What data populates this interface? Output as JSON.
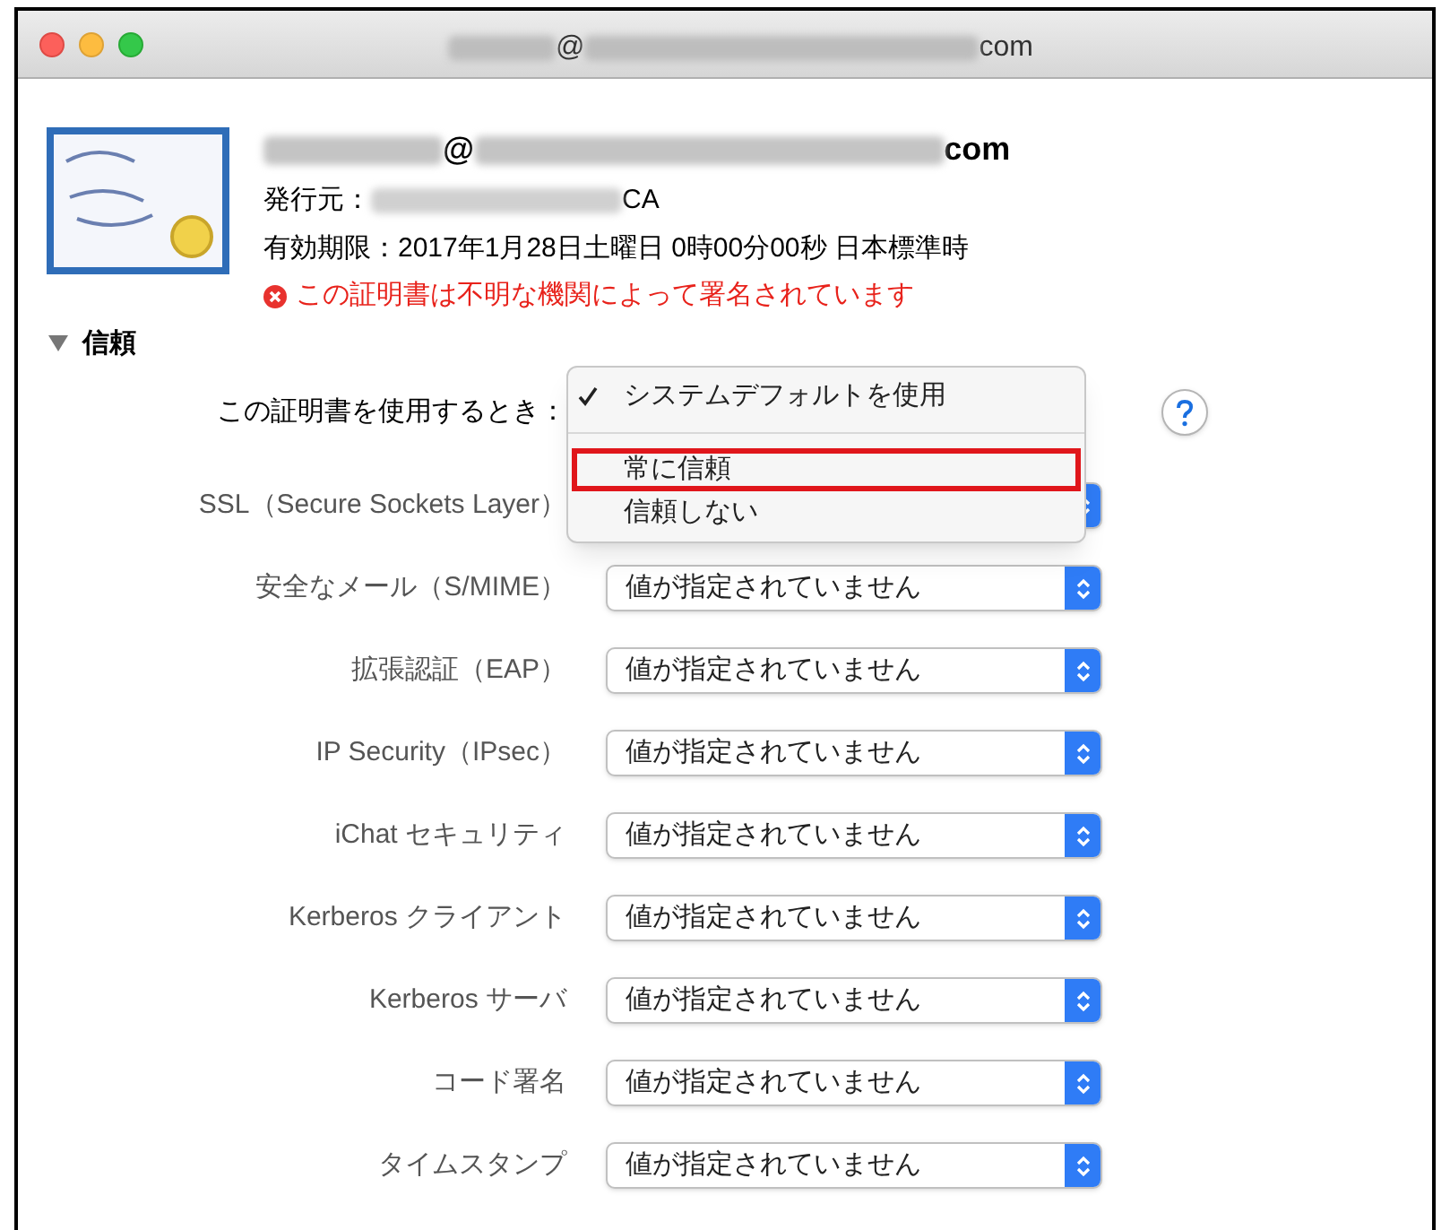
{
  "window": {
    "title": {
      "at": "@",
      "suffix": "com"
    }
  },
  "certificate": {
    "subject": {
      "at": "@",
      "suffix": "com"
    },
    "issuer": {
      "label": "発行元：",
      "suffix": "CA"
    },
    "expiry": "有効期限：2017年1月28日土曜日 0時00分00秒 日本標準時",
    "warning": "この証明書は不明な機関によって署名されています"
  },
  "trust": {
    "title": "信頼",
    "expanded": true,
    "when_label": "この証明書を使用するとき：",
    "menu": [
      {
        "label": "システムデフォルトを使用",
        "checked": true,
        "highlighted": false
      },
      {
        "label": "常に信頼",
        "checked": false,
        "highlighted": true
      },
      {
        "label": "信頼しない",
        "checked": false,
        "highlighted": false
      }
    ],
    "rows": [
      {
        "label": "SSL（Secure Sockets Layer）"
      },
      {
        "label": "安全なメール（S/MIME）",
        "value": "値が指定されていません"
      },
      {
        "label": "拡張認証（EAP）",
        "value": "値が指定されていません"
      },
      {
        "label": "IP Security（IPsec）",
        "value": "値が指定されていません"
      },
      {
        "label": "iChat セキュリティ",
        "value": "値が指定されていません"
      },
      {
        "label": "Kerberos クライアント",
        "value": "値が指定されていません"
      },
      {
        "label": "Kerberos サーバ",
        "value": "値が指定されていません"
      },
      {
        "label": "コード署名",
        "value": "値が指定されていません"
      },
      {
        "label": "タイムスタンプ",
        "value": "値が指定されていません"
      }
    ]
  }
}
